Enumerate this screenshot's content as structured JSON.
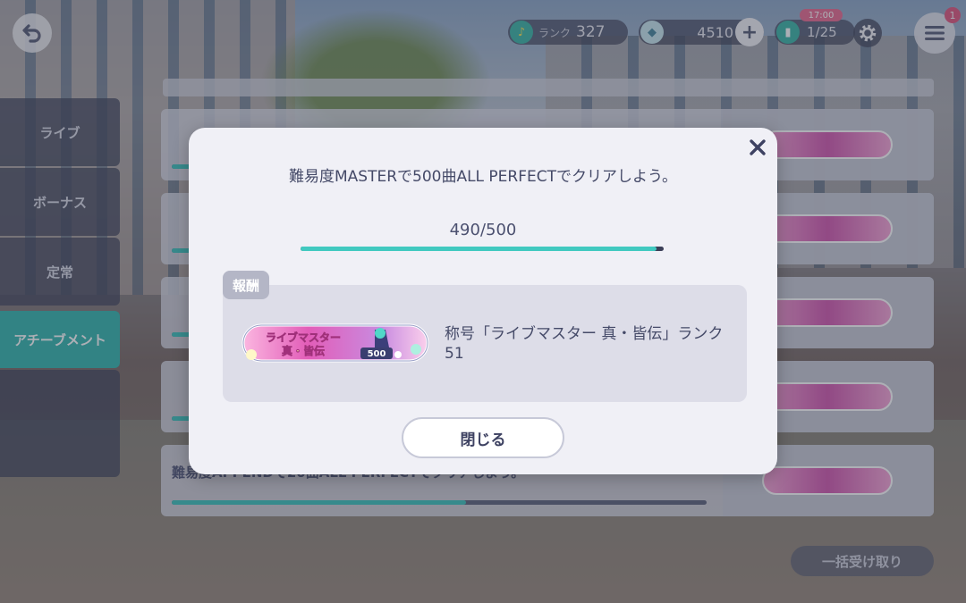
{
  "header": {
    "rank_label": "ランク",
    "rank_value": "327",
    "gems": "4510",
    "tickets": "1/25",
    "timer": "17:00",
    "notification_count": "1"
  },
  "sidebar": {
    "items": [
      {
        "label": "ライブ"
      },
      {
        "label": "ボーナス"
      },
      {
        "label": "定常"
      },
      {
        "label": "アチーブメント"
      }
    ]
  },
  "background_list": {
    "last_row_text": "難易度APPENDで20曲ALL PERFECTでクリアしよう。",
    "collect_all_label": "一括受け取り"
  },
  "dialog": {
    "mission": "難易度MASTERで500曲ALL PERFECTでクリアしよう。",
    "progress_text": "490/500",
    "progress_fraction": 0.98,
    "reward_tag": "報酬",
    "reward_text": "称号「ライブマスター 真・皆伝」ランク51",
    "plate_line1": "ライブマスター",
    "plate_line2": "真・皆伝",
    "plate_number": "500",
    "close_label": "閉じる"
  }
}
